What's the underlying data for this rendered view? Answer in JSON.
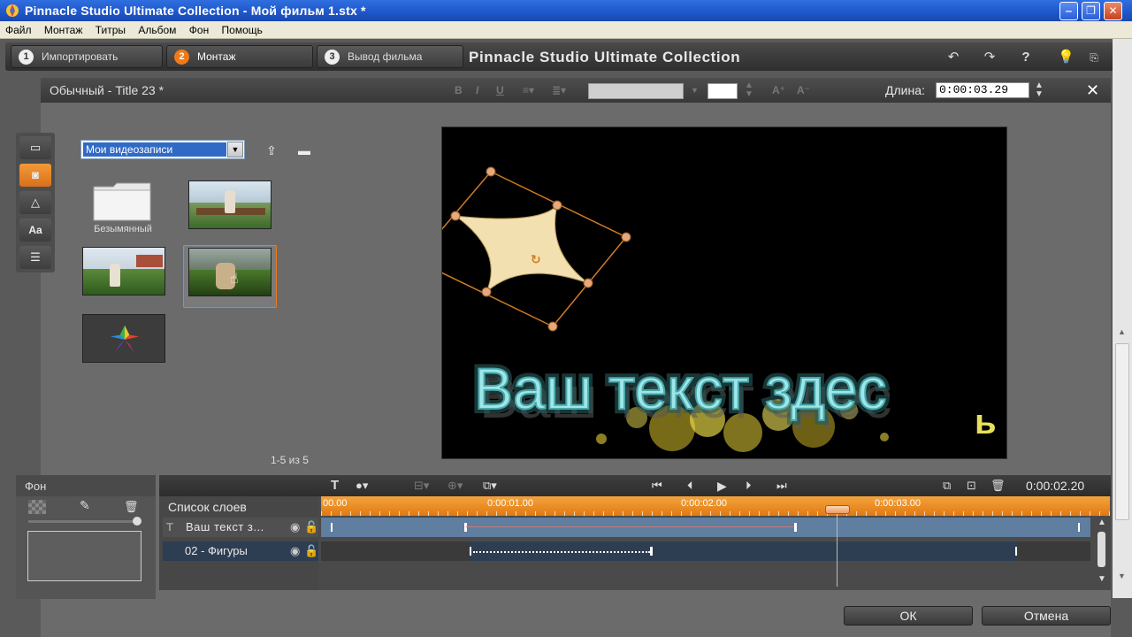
{
  "window": {
    "title": "Pinnacle Studio Ultimate Collection - Мой фильм 1.stx *"
  },
  "menu": [
    "Файл",
    "Монтаж",
    "Титры",
    "Альбом",
    "Фон",
    "Помощь"
  ],
  "nav": {
    "steps": [
      {
        "num": "1",
        "label": "Импортировать"
      },
      {
        "num": "2",
        "label": "Монтаж"
      },
      {
        "num": "3",
        "label": "Вывод фильма"
      }
    ],
    "active_step": 2,
    "app_title": "Pinnacle Studio Ultimate Collection"
  },
  "title_editor": {
    "name": "Обычный - Title 23 *",
    "length_label": "Длина:",
    "length_value": "0:00:03.29",
    "format_buttons": [
      "B",
      "I",
      "U"
    ]
  },
  "album": {
    "folder": "Мои видеозаписи",
    "folder_item_label": "Безымянный",
    "pager": "1-5 из 5"
  },
  "preview": {
    "text": "Ваш текст здес",
    "overflow_letter": "ь"
  },
  "background_panel": {
    "label": "Фон"
  },
  "timeline": {
    "current_time": "0:00:02.20",
    "layers_title": "Список слоев",
    "layers": [
      {
        "name": "Ваш текст з...",
        "type": "text"
      },
      {
        "name": "02 - Фигуры",
        "type": "shape"
      }
    ],
    "ruler_labels": [
      "00.00",
      "0:00:01.00",
      "0:00:02.00",
      "0:00:03.00"
    ]
  },
  "buttons": {
    "ok": "ОК",
    "cancel": "Отмена"
  },
  "colors": {
    "accent": "#f07a1a",
    "selection": "#316ac5",
    "text_glow": "#9ee7e8"
  }
}
